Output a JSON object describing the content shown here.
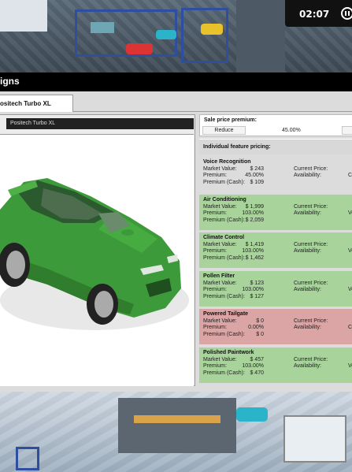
{
  "hud": {
    "time": "02:07"
  },
  "window": {
    "title": "igns",
    "tab_label": "ositech Turbo XL",
    "design_name": "Positech Turbo XL"
  },
  "sale": {
    "title": "Sale price premium:",
    "reduce_label": "Reduce",
    "value": "45.00%"
  },
  "features_header": "Individual feature pricing:",
  "labels": {
    "market_value": "Market Value:",
    "premium": "Premium:",
    "premium_cash": "Premium (Cash):",
    "current_price": "Current Price:",
    "availability": "Availability:"
  },
  "features": [
    {
      "name": "Voice Recognition",
      "market_value": "$ 243",
      "premium": "45.00%",
      "premium_cash": "$ 109",
      "avail_cut": "C",
      "status": "neutral"
    },
    {
      "name": "Air Conditioning",
      "market_value": "$ 1,999",
      "premium": "103.00%",
      "premium_cash": "$ 2,059",
      "avail_cut": "Ve",
      "status": "green"
    },
    {
      "name": "Climate Control",
      "market_value": "$ 1,419",
      "premium": "103.00%",
      "premium_cash": "$ 1,462",
      "avail_cut": "Ve",
      "status": "green"
    },
    {
      "name": "Pollen Filter",
      "market_value": "$ 123",
      "premium": "103.00%",
      "premium_cash": "$ 127",
      "avail_cut": "Ve",
      "status": "green"
    },
    {
      "name": "Powered Tailgate",
      "market_value": "$ 0",
      "premium": "0.00%",
      "premium_cash": "$ 0",
      "avail_cut": "C",
      "status": "red"
    },
    {
      "name": "Polished Paintwork",
      "market_value": "$ 457",
      "premium": "103.00%",
      "premium_cash": "$ 470",
      "avail_cut": "Ve",
      "status": "green"
    }
  ],
  "colors": {
    "car_body": "#3d9a3a",
    "positive": "#a8d49c",
    "negative": "#dba5a5",
    "neutral": "#dcdcdc"
  }
}
